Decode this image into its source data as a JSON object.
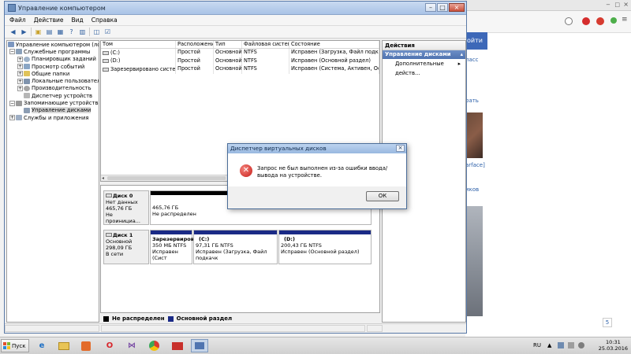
{
  "window": {
    "title": "Управление компьютером",
    "menu": [
      "Файл",
      "Действие",
      "Вид",
      "Справка"
    ]
  },
  "tree": {
    "root": "Управление компьютером (лока",
    "items": [
      {
        "label": "Служебные программы",
        "level": 1,
        "expand": "−"
      },
      {
        "label": "Планировщик заданий",
        "level": 2,
        "expand": "+"
      },
      {
        "label": "Просмотр событий",
        "level": 2,
        "expand": "+"
      },
      {
        "label": "Общие папки",
        "level": 2,
        "expand": "+"
      },
      {
        "label": "Локальные пользовател",
        "level": 2,
        "expand": "+"
      },
      {
        "label": "Производительность",
        "level": 2,
        "expand": "+"
      },
      {
        "label": "Диспетчер устройств",
        "level": 2,
        "expand": ""
      },
      {
        "label": "Запоминающие устройства",
        "level": 1,
        "expand": "−"
      },
      {
        "label": "Управление дисками",
        "level": 2,
        "expand": "",
        "selected": true
      },
      {
        "label": "Службы и приложения",
        "level": 1,
        "expand": "+"
      }
    ]
  },
  "volumes": {
    "columns": [
      "Том",
      "Расположение",
      "Тип",
      "Файловая система",
      "Состояние"
    ],
    "rows": [
      [
        "(C:)",
        "Простой",
        "Основной",
        "NTFS",
        "Исправен (Загрузка, Файл подкачк"
      ],
      [
        "(D:)",
        "Простой",
        "Основной",
        "NTFS",
        "Исправен (Основной раздел)"
      ],
      [
        "Зарезервировано системой",
        "Простой",
        "Основной",
        "NTFS",
        "Исправен (Система, Активен, Осно"
      ]
    ]
  },
  "disks": [
    {
      "name": "Диск 0",
      "lines": [
        "Нет данных",
        "465,76 ГБ",
        "Не проинициа..."
      ],
      "partitions": [
        {
          "size": "465,76 ГБ",
          "status": "Не распределен",
          "bar": "#000000"
        }
      ]
    },
    {
      "name": "Диск 1",
      "lines": [
        "Основной",
        "298,09 ГБ",
        "В сети"
      ],
      "partitions": [
        {
          "title": "Зарезервиров",
          "size": "350 МБ NTFS",
          "status": "Исправен (Сист",
          "bar": "#1a2a86"
        },
        {
          "title": "(C:)",
          "size": "97,31 ГБ NTFS",
          "status": "Исправен (Загрузка, Файл подкачк",
          "bar": "#1a2a86"
        },
        {
          "title": "(D:)",
          "size": "200,43 ГБ NTFS",
          "status": "Исправен (Основной раздел)",
          "bar": "#1a2a86"
        }
      ]
    }
  ],
  "legend": {
    "unallocated": "Не распределен",
    "primary": "Основной раздел",
    "unallocated_color": "#000000",
    "primary_color": "#1a2a86"
  },
  "actions": {
    "header": "Действия",
    "section": "Управление дисками",
    "item": "Дополнительные действ..."
  },
  "dialog": {
    "title": "Диспетчер виртуальных дисков",
    "message": "Запрос не был выполнен из-за ошибки ввода/вывода на устройстве.",
    "ok": "ОК",
    "icon": "error-icon"
  },
  "browser": {
    "snippets": [
      "ойти",
      "ласс",
      "рать",
      "arface]",
      "иков"
    ],
    "page_counter": "5"
  },
  "taskbar": {
    "start": "Пуск",
    "lang": "RU",
    "time": "10:31",
    "date": "25.03.2016",
    "apps": [
      "ie-icon",
      "explorer-icon",
      "media-player-icon",
      "opera-icon",
      "visual-studio-icon",
      "chrome-icon",
      "toolbox-icon",
      "computer-management-icon"
    ]
  },
  "colors": {
    "accent": "#4e72b0",
    "primary_partition": "#1a2a86",
    "error": "#c81f1a"
  }
}
